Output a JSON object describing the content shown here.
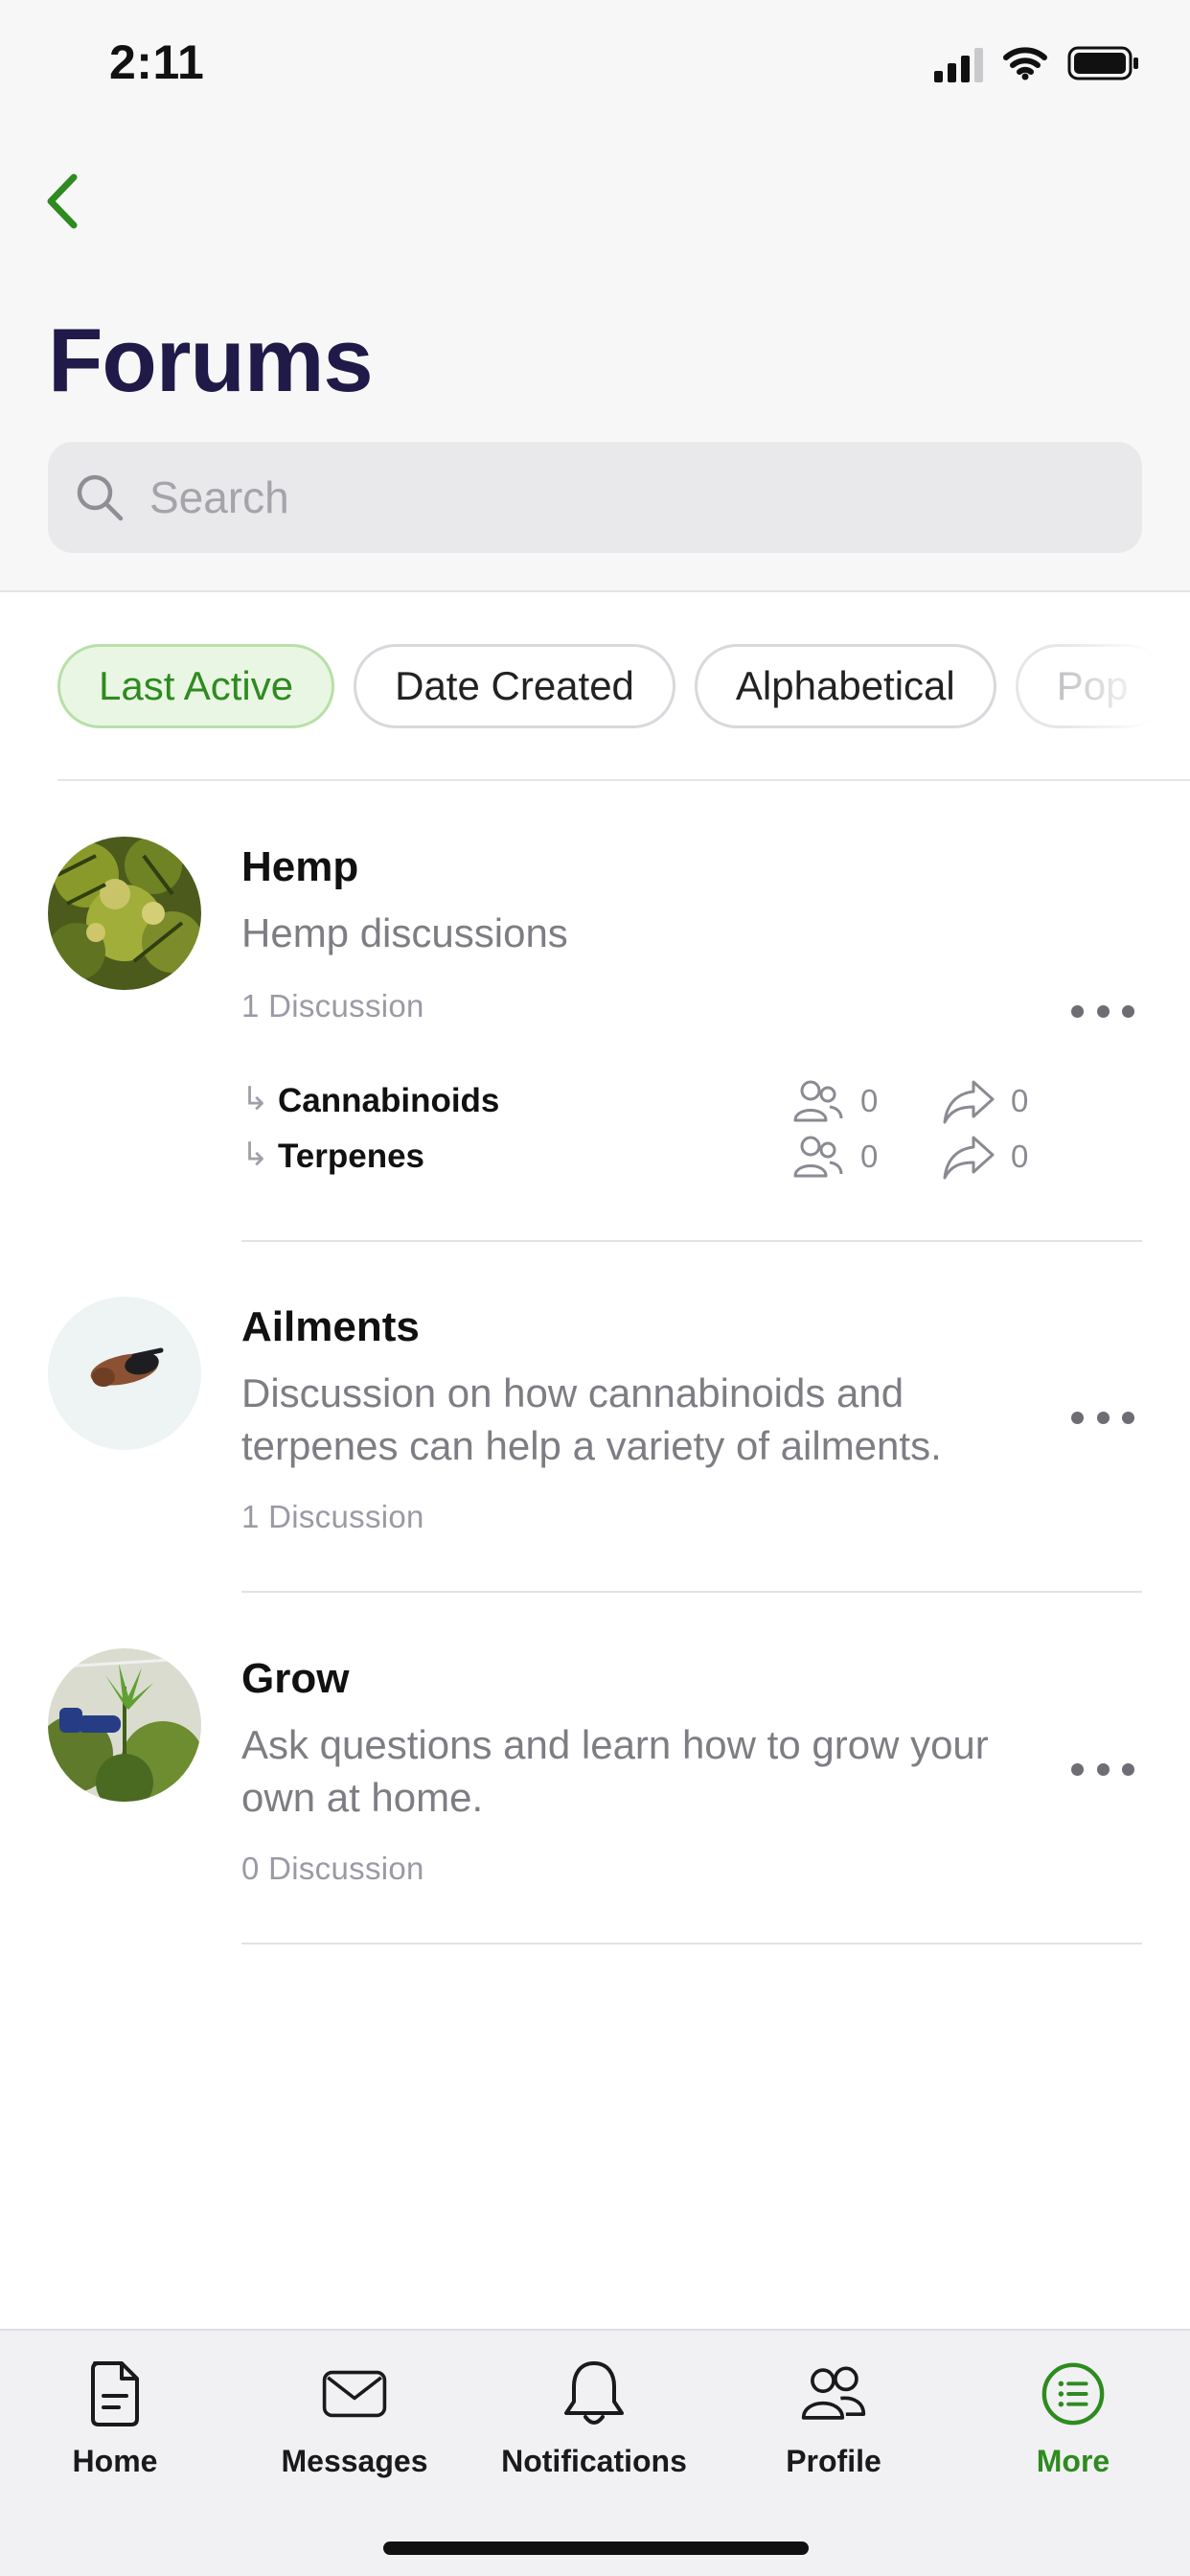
{
  "status_bar": {
    "time": "2:11"
  },
  "header": {
    "title": "Forums"
  },
  "search": {
    "placeholder": "Search"
  },
  "filters": [
    "Last Active",
    "Date Created",
    "Alphabetical",
    "Pop"
  ],
  "forums": [
    {
      "title": "Hemp",
      "description": "Hemp discussions",
      "count": "1 Discussion",
      "subforums": [
        {
          "name": "Cannabinoids",
          "members": "0",
          "shares": "0"
        },
        {
          "name": "Terpenes",
          "members": "0",
          "shares": "0"
        }
      ]
    },
    {
      "title": "Ailments",
      "description": "Discussion on how cannabinoids and terpenes can help a variety of ailments.",
      "count": "1 Discussion"
    },
    {
      "title": "Grow",
      "description": "Ask questions and learn how to grow your own at home.",
      "count": "0 Discussion"
    }
  ],
  "tabbar": {
    "items": [
      {
        "label": "Home",
        "icon": "document-icon"
      },
      {
        "label": "Messages",
        "icon": "envelope-icon"
      },
      {
        "label": "Notifications",
        "icon": "bell-icon"
      },
      {
        "label": "Profile",
        "icon": "people-icon"
      },
      {
        "label": "More",
        "icon": "list-icon"
      }
    ]
  },
  "colors": {
    "accent": "#2e8b1f",
    "title": "#1f1a48",
    "active_chip_bg": "#eaf6e4"
  }
}
